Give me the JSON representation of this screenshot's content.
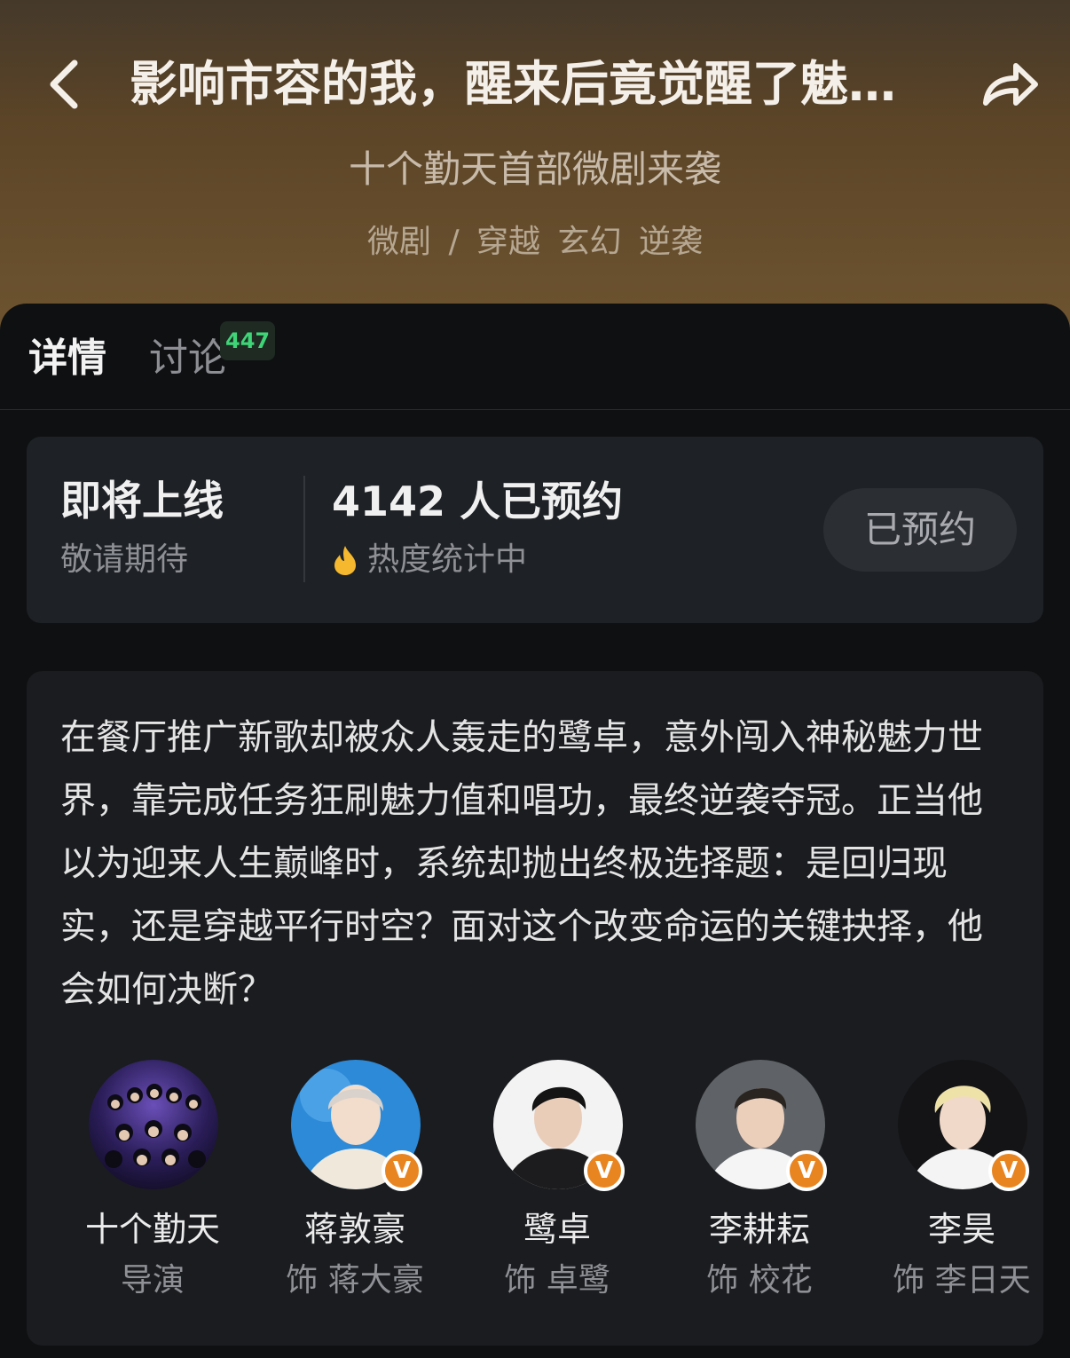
{
  "header": {
    "title": "影响市容的我，醒来后竟觉醒了魅…",
    "subtitle": "十个勤天首部微剧来袭",
    "tags": [
      "微剧",
      "/",
      "穿越",
      "玄幻",
      "逆袭"
    ],
    "back_icon": "chevron-left-icon",
    "share_icon": "share-arrow-icon"
  },
  "tabs": {
    "detail": "详情",
    "discuss": "讨论",
    "discuss_count": "447"
  },
  "status": {
    "title": "即将上线",
    "subtitle": "敬请期待",
    "reserve_count": "4142 人已预约",
    "heat_text": "热度统计中",
    "reserve_button": "已预约"
  },
  "description": "在餐厅推广新歌却被众人轰走的鹭卓，意外闯入神秘魅力世界，靠完成任务狂刷魅力值和唱功，最终逆袭夺冠。正当他以为迎来人生巅峰时，系统却抛出终极选择题：是回归现实，还是穿越平行时空？面对这个改变命运的关键抉择，他会如何决断？",
  "cast": [
    {
      "name": "十个勤天",
      "role": "导演",
      "verified": false
    },
    {
      "name": "蒋敦豪",
      "role": "饰 蒋大豪",
      "verified": true
    },
    {
      "name": "鹭卓",
      "role": "饰 卓鹭",
      "verified": true
    },
    {
      "name": "李耕耘",
      "role": "饰 校花",
      "verified": true
    },
    {
      "name": "李昊",
      "role": "饰 李日天",
      "verified": true
    }
  ],
  "colors": {
    "accent_green": "#3fd477",
    "verified_orange": "#e88520",
    "hero_brown": "#6e5430"
  }
}
